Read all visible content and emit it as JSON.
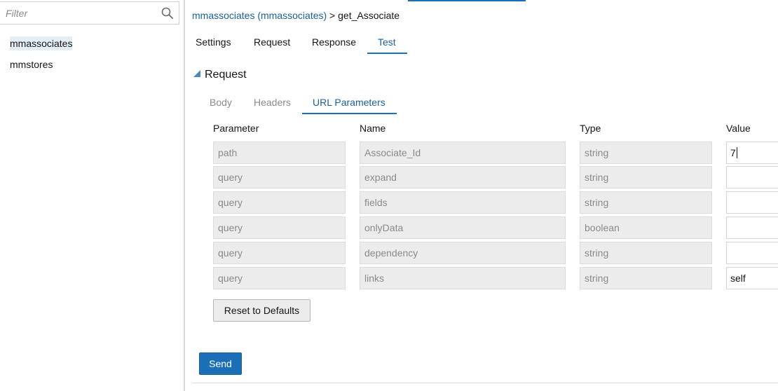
{
  "sidebar": {
    "filter_placeholder": "Filter",
    "items": [
      {
        "label": "mmassociates",
        "selected": true
      },
      {
        "label": "mmstores",
        "selected": false
      }
    ]
  },
  "breadcrumb": {
    "link": "mmassociates (mmassociates)",
    "separator": ">",
    "current": "get_Associate"
  },
  "tabs": [
    {
      "label": "Settings",
      "active": false
    },
    {
      "label": "Request",
      "active": false
    },
    {
      "label": "Response",
      "active": false
    },
    {
      "label": "Test",
      "active": true
    }
  ],
  "section": {
    "title": "Request",
    "expanded": true
  },
  "subtabs": [
    {
      "label": "Body",
      "active": false
    },
    {
      "label": "Headers",
      "active": false
    },
    {
      "label": "URL Parameters",
      "active": true
    }
  ],
  "table": {
    "headers": [
      "Parameter",
      "Name",
      "Type",
      "Value"
    ],
    "rows": [
      {
        "parameter": "path",
        "name": "Associate_Id",
        "type": "string",
        "value": "7"
      },
      {
        "parameter": "query",
        "name": "expand",
        "type": "string",
        "value": ""
      },
      {
        "parameter": "query",
        "name": "fields",
        "type": "string",
        "value": ""
      },
      {
        "parameter": "query",
        "name": "onlyData",
        "type": "boolean",
        "value": ""
      },
      {
        "parameter": "query",
        "name": "dependency",
        "type": "string",
        "value": ""
      },
      {
        "parameter": "query",
        "name": "links",
        "type": "string",
        "value": "self"
      }
    ]
  },
  "buttons": {
    "reset": "Reset to Defaults",
    "send": "Send"
  },
  "colors": {
    "accent": "#1b6fb6",
    "link": "#1a5f9c",
    "readonly_cell": "#ececec"
  },
  "icons": {
    "search": "search-icon",
    "expand": "triangle-down-icon"
  }
}
